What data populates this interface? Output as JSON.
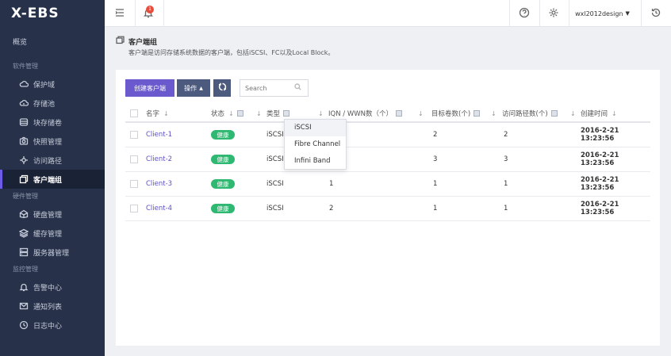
{
  "brand": "X-EBS",
  "sidebar": {
    "overview": "概览",
    "groups": [
      {
        "label": "软件管理",
        "items": [
          {
            "label": "保护域",
            "icon": "cloud-icon"
          },
          {
            "label": "存储池",
            "icon": "cloud-storage-icon"
          },
          {
            "label": "块存储卷",
            "icon": "database-icon"
          },
          {
            "label": "快照管理",
            "icon": "camera-icon"
          },
          {
            "label": "访问路径",
            "icon": "path-icon"
          },
          {
            "label": "客户端组",
            "icon": "client-group-icon",
            "active": true
          }
        ]
      },
      {
        "label": "硬件管理",
        "items": [
          {
            "label": "硬盘管理",
            "icon": "disk-icon"
          },
          {
            "label": "缓存管理",
            "icon": "layers-icon"
          },
          {
            "label": "服务器管理",
            "icon": "server-icon"
          }
        ]
      },
      {
        "label": "监控管理",
        "items": [
          {
            "label": "告警中心",
            "icon": "bell-icon"
          },
          {
            "label": "通知列表",
            "icon": "mail-icon"
          },
          {
            "label": "日志中心",
            "icon": "clock-icon"
          }
        ]
      }
    ]
  },
  "header": {
    "notification_count": "1",
    "user": "wxl2012design"
  },
  "page": {
    "title": "客户端组",
    "description": "客户端是访问存储系统数据的客户端，包括iSCSI、FC以及Local Block。"
  },
  "toolbar": {
    "create_label": "创建客户端",
    "operation_label": "操作",
    "search_placeholder": "Search"
  },
  "table": {
    "columns": {
      "name": "名字",
      "status": "状态",
      "type": "类型",
      "iqn": "IQN / WWN数（个）",
      "volumes": "目标卷数(个)",
      "paths": "访问路径数(个)",
      "created": "创建时间"
    },
    "rows": [
      {
        "name": "Client-1",
        "status": "健康",
        "type": "iSCSI",
        "iqn": "",
        "volumes": "2",
        "paths": "2",
        "created": "2016-2-21  13:23:56"
      },
      {
        "name": "Client-2",
        "status": "健康",
        "type": "iSCSI",
        "iqn": "",
        "volumes": "3",
        "paths": "3",
        "created": "2016-2-21  13:23:56"
      },
      {
        "name": "Client-3",
        "status": "健康",
        "type": "iSCSI",
        "iqn": "1",
        "volumes": "1",
        "paths": "1",
        "created": "2016-2-21  13:23:56"
      },
      {
        "name": "Client-4",
        "status": "健康",
        "type": "iSCSI",
        "iqn": "2",
        "volumes": "1",
        "paths": "1",
        "created": "2016-2-21  13:23:56"
      }
    ]
  },
  "type_filter": {
    "options": [
      "iSCSI",
      "Fibre Channel",
      "Infini Band"
    ]
  }
}
